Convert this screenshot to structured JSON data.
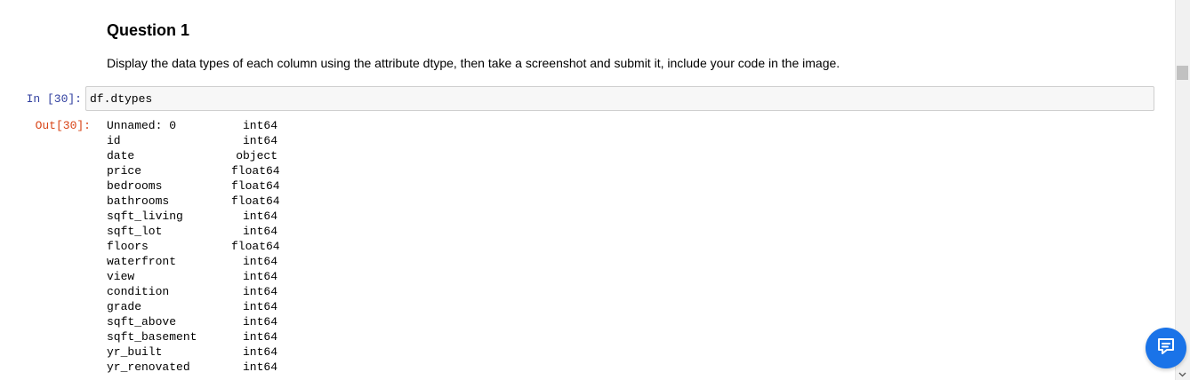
{
  "markdown": {
    "heading": "Question 1",
    "text": "Display the data types of each column using the attribute dtype, then take a screenshot and submit it, include your code in the image."
  },
  "input_cell": {
    "prompt": "In [30]:",
    "code": "df.dtypes"
  },
  "output_cell": {
    "prompt": "Out[30]:",
    "rows": [
      {
        "name": "Unnamed: 0",
        "dtype": "int64"
      },
      {
        "name": "id",
        "dtype": "int64"
      },
      {
        "name": "date",
        "dtype": "object"
      },
      {
        "name": "price",
        "dtype": "float64"
      },
      {
        "name": "bedrooms",
        "dtype": "float64"
      },
      {
        "name": "bathrooms",
        "dtype": "float64"
      },
      {
        "name": "sqft_living",
        "dtype": "int64"
      },
      {
        "name": "sqft_lot",
        "dtype": "int64"
      },
      {
        "name": "floors",
        "dtype": "float64"
      },
      {
        "name": "waterfront",
        "dtype": "int64"
      },
      {
        "name": "view",
        "dtype": "int64"
      },
      {
        "name": "condition",
        "dtype": "int64"
      },
      {
        "name": "grade",
        "dtype": "int64"
      },
      {
        "name": "sqft_above",
        "dtype": "int64"
      },
      {
        "name": "sqft_basement",
        "dtype": "int64"
      },
      {
        "name": "yr_built",
        "dtype": "int64"
      },
      {
        "name": "yr_renovated",
        "dtype": "int64"
      }
    ]
  },
  "colors": {
    "in_prompt": "#303F9F",
    "out_prompt": "#D84315",
    "chat_button": "#1a73e8"
  },
  "icons": {
    "chat_button": "chat-icon",
    "scroll_down": "chevron-down-icon"
  }
}
